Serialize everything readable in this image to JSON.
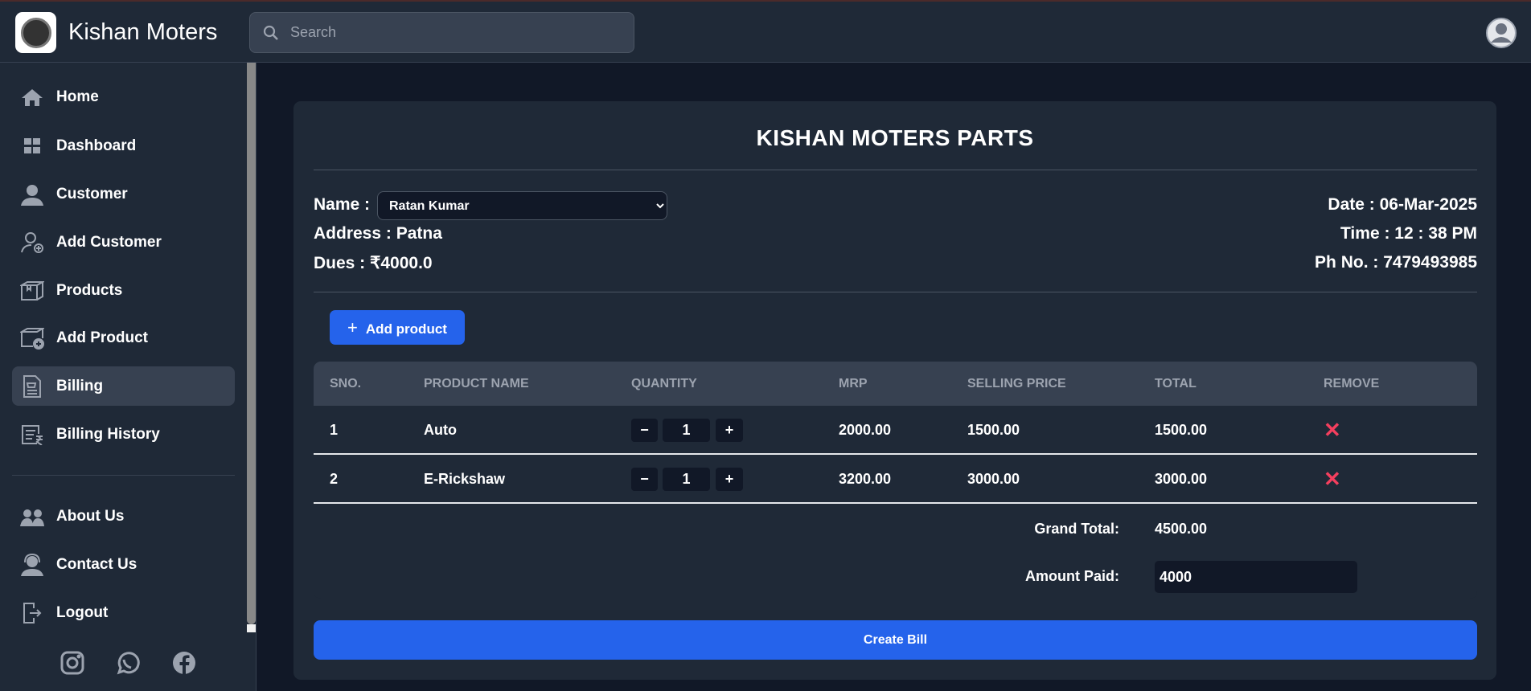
{
  "header": {
    "brand": "Kishan Moters",
    "search_placeholder": "Search"
  },
  "sidebar": {
    "items": [
      {
        "label": "Home",
        "icon": "home-icon"
      },
      {
        "label": "Dashboard",
        "icon": "grid-icon"
      },
      {
        "label": "Customer",
        "icon": "user-icon"
      },
      {
        "label": "Add Customer",
        "icon": "add-user-icon"
      },
      {
        "label": "Products",
        "icon": "box-icon"
      },
      {
        "label": "Add Product",
        "icon": "add-box-icon"
      },
      {
        "label": "Billing",
        "icon": "bill-icon",
        "active": true
      },
      {
        "label": "Billing History",
        "icon": "bill-history-icon"
      }
    ],
    "bottom_items": [
      {
        "label": "About Us",
        "icon": "team-icon"
      },
      {
        "label": "Contact Us",
        "icon": "support-icon"
      },
      {
        "label": "Logout",
        "icon": "logout-icon"
      }
    ],
    "social": [
      "instagram-icon",
      "whatsapp-icon",
      "facebook-icon"
    ]
  },
  "bill": {
    "title": "KISHAN MOTERS PARTS",
    "name_label": "Name :",
    "customer": "Ratan Kumar",
    "address": "Address : Patna",
    "dues": "Dues : ₹4000.0",
    "date": "Date : 06-Mar-2025",
    "time": "Time : 12 : 38 PM",
    "phone": "Ph No. : 7479493985",
    "add_product": "Add product",
    "columns": [
      "SNO.",
      "PRODUCT NAME",
      "QUANTITY",
      "MRP",
      "SELLING PRICE",
      "TOTAL",
      "REMOVE"
    ],
    "rows": [
      {
        "sno": "1",
        "name": "Auto",
        "qty": "1",
        "mrp": "2000.00",
        "price": "1500.00",
        "total": "1500.00"
      },
      {
        "sno": "2",
        "name": "E-Rickshaw",
        "qty": "1",
        "mrp": "3200.00",
        "price": "3000.00",
        "total": "3000.00"
      }
    ],
    "grand_total_label": "Grand Total:",
    "grand_total": "4500.00",
    "amount_paid_label": "Amount Paid:",
    "amount_paid": "4000",
    "minus": "−",
    "plus": "+",
    "remove": "✕",
    "create_bill": "Create Bill"
  },
  "colors": {
    "accent": "#2563eb",
    "remove": "#f43f5e",
    "bg": "#111827",
    "panel": "#1f2937"
  }
}
